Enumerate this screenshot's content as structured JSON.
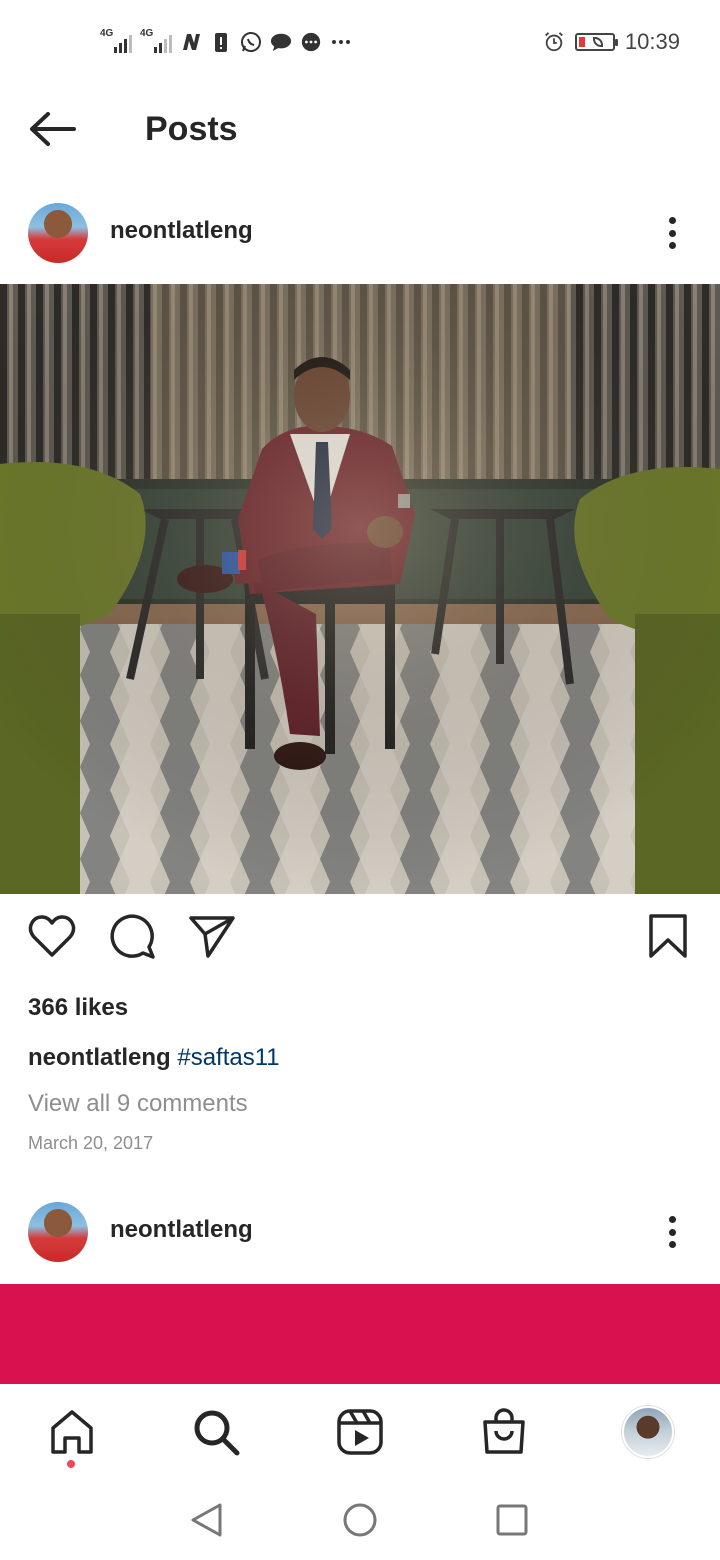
{
  "status_bar": {
    "network_1": "4G",
    "network_2": "4G",
    "time": "10:39",
    "icons": [
      "signal-icon",
      "signal-icon",
      "n-app-icon",
      "alert-icon",
      "whatsapp-icon",
      "message-icon",
      "chat-bubble-icon",
      "more-dots-icon",
      "alarm-icon",
      "battery-icon"
    ]
  },
  "header": {
    "title": "Posts",
    "back_icon": "arrow-left-icon"
  },
  "posts": [
    {
      "username": "neontlatleng",
      "likes": "366 likes",
      "caption_user": "neontlatleng",
      "caption_text": "#saftas11",
      "comments_link": "View all 9 comments",
      "date": "March 20, 2017"
    },
    {
      "username": "neontlatleng"
    }
  ],
  "actions": {
    "icons": [
      "heart-icon",
      "comment-icon",
      "share-icon",
      "bookmark-icon"
    ]
  },
  "bottom_nav": {
    "items": [
      "home-icon",
      "search-icon",
      "reels-icon",
      "shop-icon",
      "profile-avatar"
    ]
  },
  "colors": {
    "accent_link": "#00376b",
    "notification_dot": "#ed4956",
    "second_post_bg": "#d8124f",
    "text": "#262626",
    "muted": "#8e8e8e"
  }
}
